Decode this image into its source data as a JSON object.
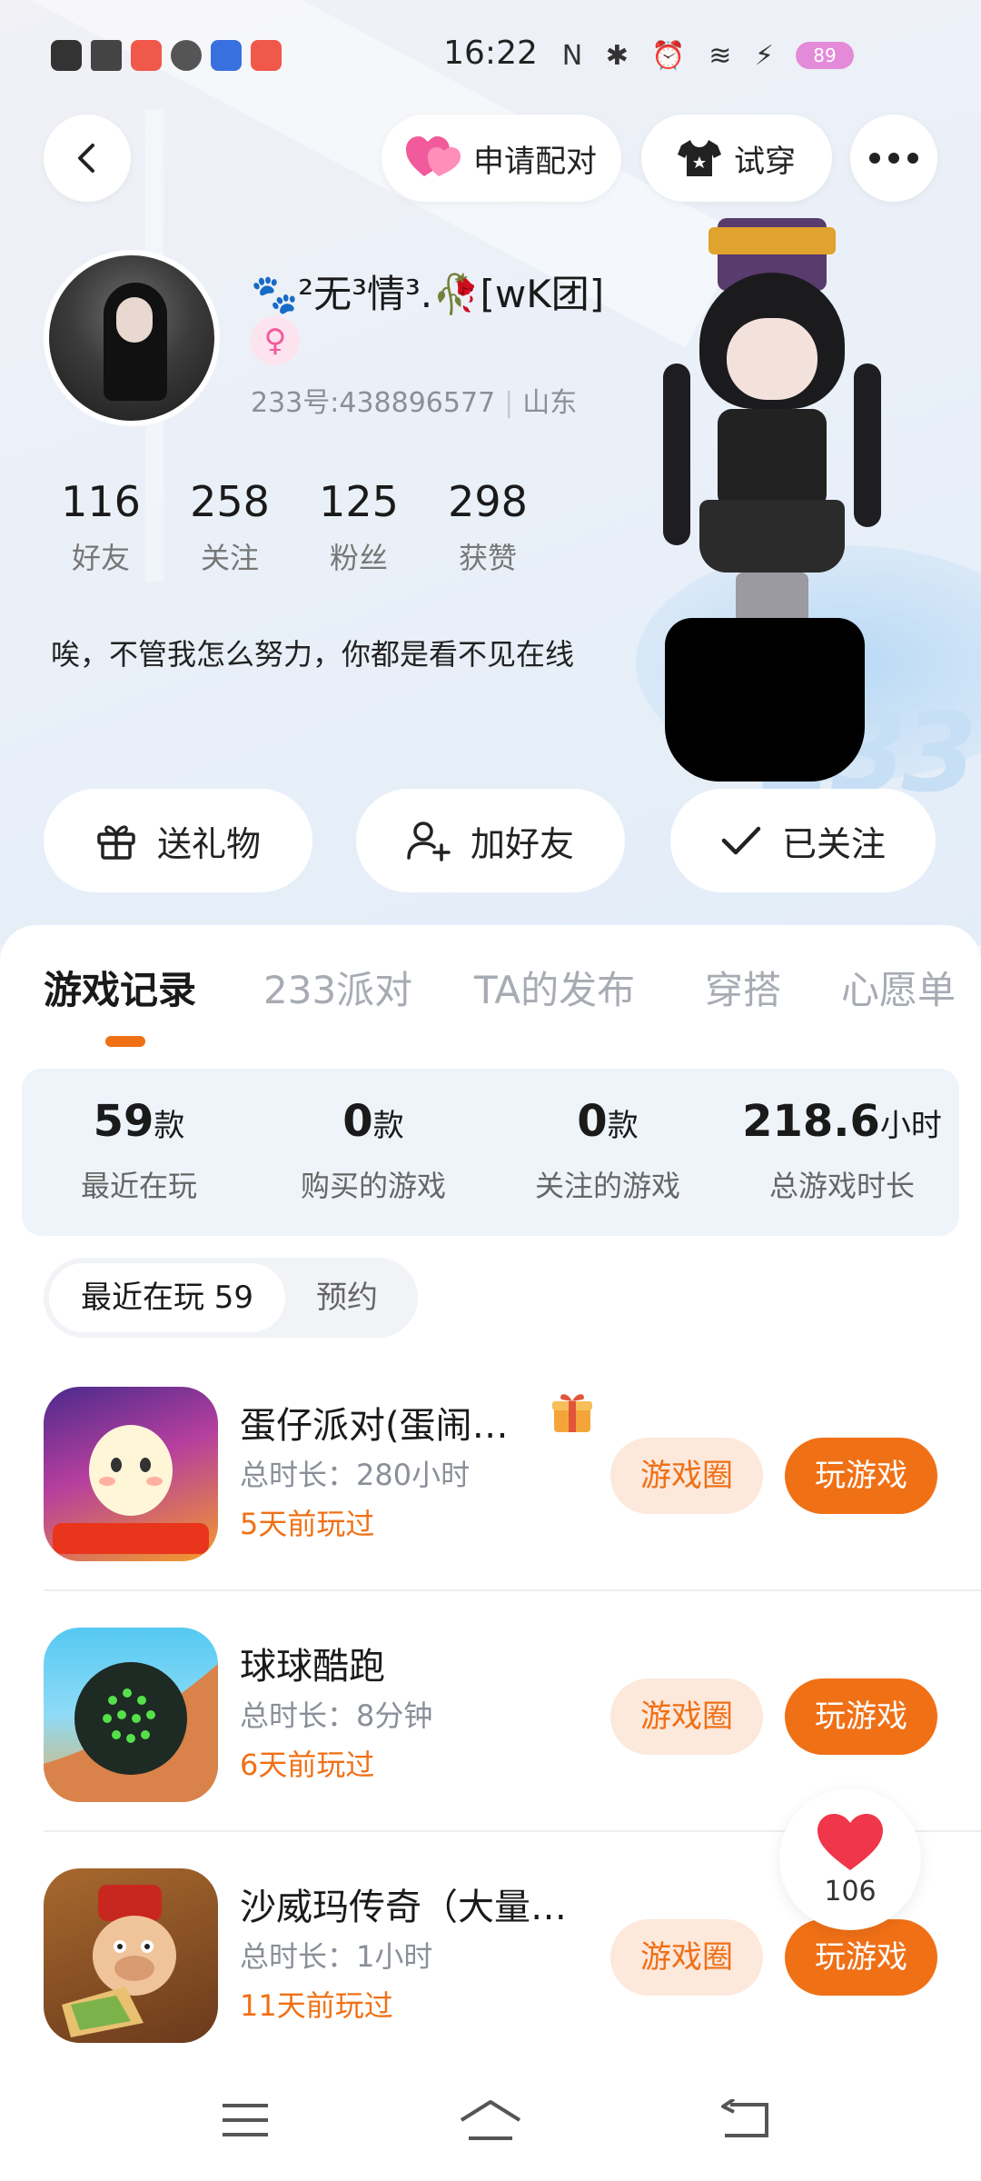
{
  "status_bar": {
    "time": "16:22",
    "battery": "89",
    "right_icons": "N ✱ ⏰ ≋ ⚡"
  },
  "header": {
    "pair_label": "申请配对",
    "tryon_label": "试穿"
  },
  "profile": {
    "nickname": "🐾²无³情³.🥀[wK团]",
    "gender_symbol": "♀",
    "id_text": "233号:438896577",
    "location": "山东",
    "bio": "唉，不管我怎么努力，你都是看不见在线",
    "stats": [
      {
        "value": "116",
        "label": "好友"
      },
      {
        "value": "258",
        "label": "关注"
      },
      {
        "value": "125",
        "label": "粉丝"
      },
      {
        "value": "298",
        "label": "获赞"
      }
    ]
  },
  "actions": {
    "gift": "送礼物",
    "add_friend": "加好友",
    "followed": "已关注"
  },
  "tabs": [
    "游戏记录",
    "233派对",
    "TA的发布",
    "穿搭",
    "心愿单"
  ],
  "summary": [
    {
      "value": "59",
      "unit": "款",
      "label": "最近在玩"
    },
    {
      "value": "0",
      "unit": "款",
      "label": "购买的游戏"
    },
    {
      "value": "0",
      "unit": "款",
      "label": "关注的游戏"
    },
    {
      "value": "218.6",
      "unit": "小时",
      "label": "总游戏时长"
    }
  ],
  "subtabs": {
    "recent": "最近在玩 59",
    "reserve": "预约"
  },
  "games": [
    {
      "title": "蛋仔派对(蛋闹…",
      "duration": "总时长：280小时",
      "last_played": "5天前玩过",
      "circle": "游戏圈",
      "play": "玩游戏"
    },
    {
      "title": "球球酷跑",
      "duration": "总时长：8分钟",
      "last_played": "6天前玩过",
      "circle": "游戏圈",
      "play": "玩游戏"
    },
    {
      "title": "沙威玛传奇（大量…",
      "duration": "总时长：1小时",
      "last_played": "11天前玩过",
      "circle": "游戏圈",
      "play": "玩游戏"
    }
  ],
  "like_count": "106",
  "colors": {
    "accent": "#f07016",
    "accent_light": "#fde8dc",
    "pink": "#f25b9b"
  }
}
